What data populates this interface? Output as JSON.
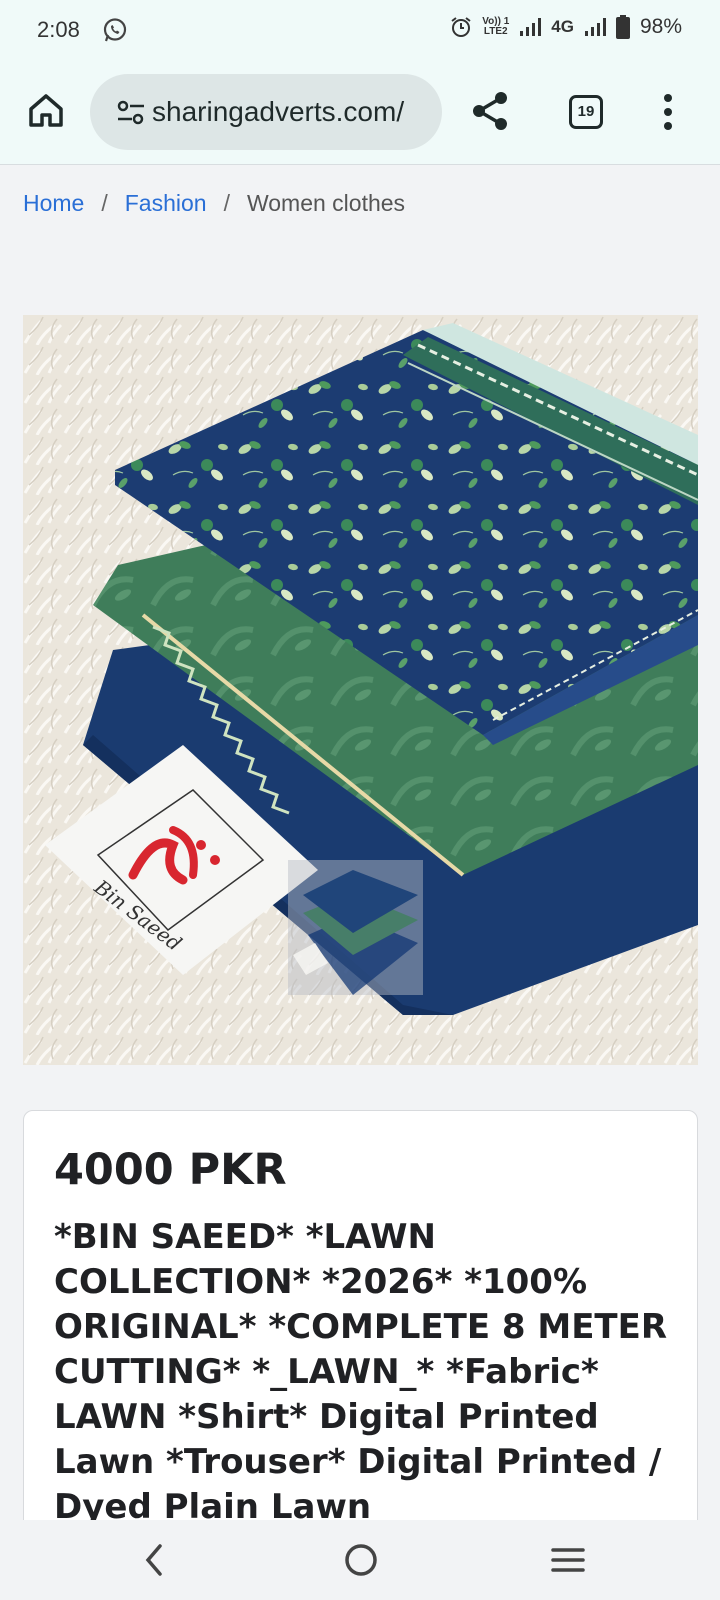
{
  "status_bar": {
    "time": "2:08",
    "network": "4G",
    "volte_line1": "Vo)) 1",
    "volte_line2": "LTE2",
    "battery": "98%"
  },
  "browser": {
    "url": "sharingadverts.com/",
    "tab_count": "19"
  },
  "breadcrumb": {
    "items": [
      "Home",
      "Fashion",
      "Women clothes"
    ],
    "separator": "/"
  },
  "product": {
    "brand_tag": "Bin Saeed",
    "price": "4000 PKR",
    "description": "*BIN SAEED* *LAWN COLLECTION* *2026* *100% ORIGINAL* *COMPLETE 8 METER CUTTING* *_LAWN_* *Fabric* LAWN *Shirt* Digital Printed Lawn *Trouser* Digital Printed / Dyed Plain Lawn"
  },
  "colors": {
    "link": "#2a6fd6",
    "toolbar_bg": "#f0faf9",
    "navy_fabric": "#1c3c72",
    "green_fabric": "#3f7d5a"
  }
}
